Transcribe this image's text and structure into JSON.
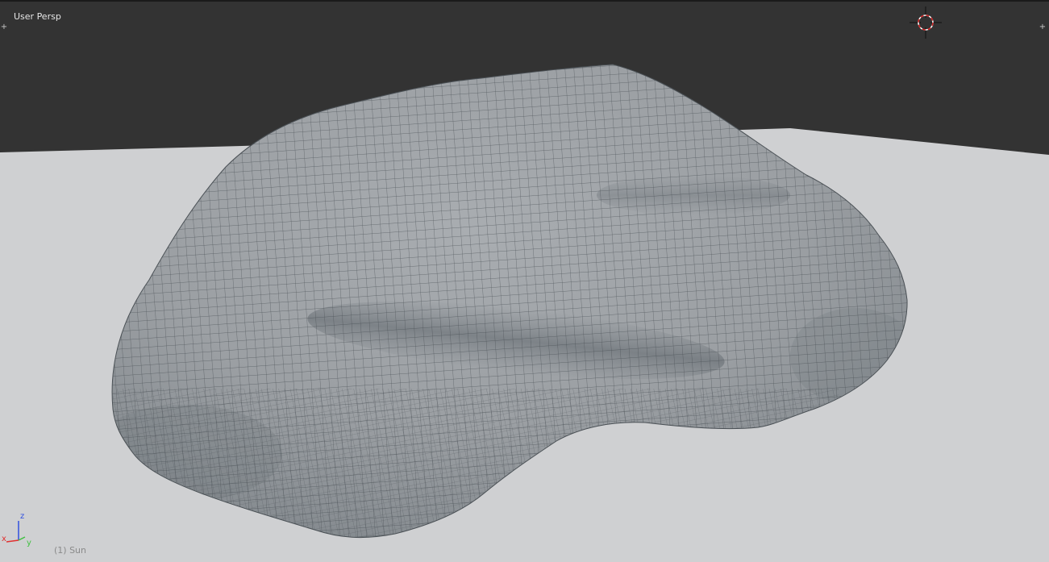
{
  "viewport": {
    "view_label": "User Persp",
    "object_label": "(1) Sun"
  },
  "axis_gizmo": {
    "x_label": "x",
    "y_label": "y",
    "z_label": "z",
    "x_color": "#e03030",
    "y_color": "#40c040",
    "z_color": "#3050e0"
  },
  "colors": {
    "background_dark": "#333333",
    "ground_plane": "#cfd0d2",
    "mesh_base": "#9a9ea2",
    "wire": "#3c4348",
    "cursor_red": "#d02020"
  },
  "icons": {
    "corner_widget": "plus-icon",
    "cursor": "3d-cursor-icon"
  }
}
